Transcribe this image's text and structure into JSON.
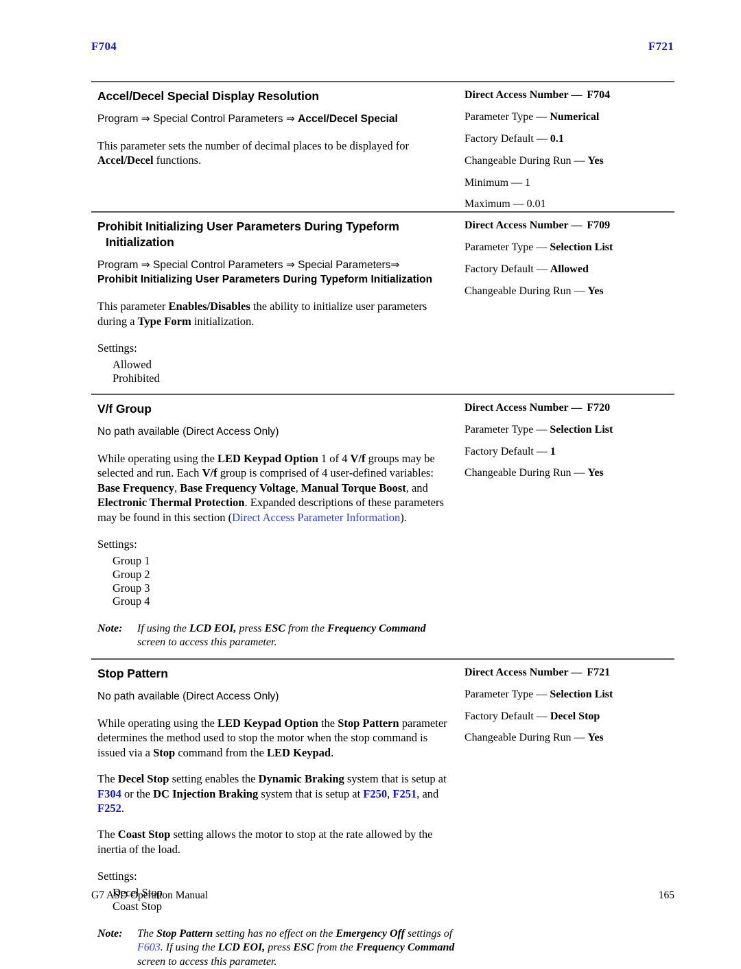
{
  "running_head": {
    "left": "F704",
    "right": "F721",
    "color": "#1515cc"
  },
  "footer": {
    "manual_title": "G7 ASD Operation Manual",
    "page_number": "165"
  },
  "meta_labels": {
    "direct_access_number": "Direct Access Number —",
    "parameter_type": "Parameter Type —",
    "factory_default": "Factory Default —",
    "changeable_during_run": "Changeable During Run —",
    "minimum": "Minimum —",
    "maximum": "Maximum —"
  },
  "common": {
    "settings_label": "Settings:",
    "note_label": "Note:",
    "no_path": "No path available (Direct Access Only)"
  },
  "sections": [
    {
      "id": "accel-decel-special-display-resolution",
      "title": "Accel/Decel Special Display Resolution",
      "title_line2": "",
      "path_prefix": "Program ⇒ Special Control Parameters ⇒ ",
      "path_bold": "Accel/Decel Special",
      "description_pre": "This parameter sets the number of decimal places to be displayed for ",
      "description_bold": "Accel/Decel",
      "description_post": " functions.",
      "meta": {
        "direct_access_number": "F704",
        "parameter_type": "Numerical",
        "factory_default": "0.1",
        "changeable_during_run": "Yes",
        "minimum": "1",
        "maximum": "0.01"
      }
    },
    {
      "id": "prohibit-initializing-user-parameters",
      "title": "Prohibit Initializing User Parameters During Typeform",
      "title_line2": "Initialization",
      "path_prefix": "Program ⇒ Special Control Parameters ⇒ Special Parameters⇒",
      "path_bold": "Prohibit Initializing User Parameters During Typeform Initialization",
      "description_pre": "This parameter ",
      "description_bold": "Enables/Disables",
      "description_mid": " the ability to initialize user parameters during a ",
      "description_bold2": "Type Form",
      "description_post": " initialization.",
      "settings": [
        "Allowed",
        "Prohibited"
      ],
      "meta": {
        "direct_access_number": "F709",
        "parameter_type": "Selection List",
        "factory_default": "Allowed",
        "changeable_during_run": "Yes"
      }
    },
    {
      "id": "vf-group",
      "title": "V/f Group",
      "path": "No path available (Direct Access Only)",
      "body_parts": [
        {
          "t": "While operating using the ",
          "b": false
        },
        {
          "t": "LED Keypad Option",
          "b": true
        },
        {
          "t": " 1 of 4 ",
          "b": false
        },
        {
          "t": "V/f",
          "b": true
        },
        {
          "t": " groups may be selected and run. Each ",
          "b": false
        },
        {
          "t": "V/f",
          "b": true
        },
        {
          "t": " group is comprised of 4 user-defined variables: ",
          "b": false
        },
        {
          "t": "Base Frequency",
          "b": true
        },
        {
          "t": ", ",
          "b": false
        },
        {
          "t": "Base Frequency Voltage",
          "b": true
        },
        {
          "t": ", ",
          "b": false
        },
        {
          "t": "Manual Torque Boost",
          "b": true
        },
        {
          "t": ", and ",
          "b": false
        },
        {
          "t": "Electronic Thermal Protection",
          "b": true
        },
        {
          "t": ". Expanded descriptions of these parameters may be found in this section (",
          "b": false
        },
        {
          "t": "Direct Access Parameter Information",
          "b": false,
          "link": true
        },
        {
          "t": ").",
          "b": false
        }
      ],
      "settings": [
        "Group 1",
        "Group 2",
        "Group 3",
        "Group 4"
      ],
      "note_parts": [
        {
          "t": "If using the ",
          "b": false
        },
        {
          "t": "LCD EOI,",
          "b": true
        },
        {
          "t": " press ",
          "b": false
        },
        {
          "t": "ESC",
          "b": true
        },
        {
          "t": " from the ",
          "b": false
        },
        {
          "t": "Frequency Command",
          "b": true
        },
        {
          "t": " screen to access this parameter.",
          "b": false
        }
      ],
      "meta": {
        "direct_access_number": "F720",
        "parameter_type": "Selection List",
        "factory_default": "1",
        "changeable_during_run": "Yes"
      }
    },
    {
      "id": "stop-pattern",
      "title": "Stop Pattern",
      "path": "No path available (Direct Access Only)",
      "body_parts": [
        {
          "t": "While operating using the ",
          "b": false
        },
        {
          "t": "LED Keypad Option",
          "b": true
        },
        {
          "t": " the ",
          "b": false
        },
        {
          "t": "Stop Pattern",
          "b": true
        },
        {
          "t": " parameter determines the method used to stop the motor when the stop command is issued via a ",
          "b": false
        },
        {
          "t": "Stop",
          "b": true
        },
        {
          "t": " command from the ",
          "b": false
        },
        {
          "t": "LED Keypad",
          "b": true
        },
        {
          "t": ".",
          "b": false
        }
      ],
      "body2_parts": [
        {
          "t": "The ",
          "b": false
        },
        {
          "t": "Decel Stop",
          "b": true
        },
        {
          "t": " setting enables the ",
          "b": false
        },
        {
          "t": "Dynamic Braking",
          "b": true
        },
        {
          "t": " system that is setup at ",
          "b": false
        },
        {
          "t": "F304",
          "b": true,
          "link": true
        },
        {
          "t": " or the ",
          "b": false
        },
        {
          "t": "DC Injection Braking",
          "b": true
        },
        {
          "t": " system that is setup at ",
          "b": false
        },
        {
          "t": "F250",
          "b": true,
          "link": true
        },
        {
          "t": ", ",
          "b": false
        },
        {
          "t": "F251",
          "b": true,
          "link": true
        },
        {
          "t": ", and ",
          "b": false
        },
        {
          "t": "F252",
          "b": true,
          "link": true
        },
        {
          "t": ".",
          "b": false
        }
      ],
      "body3_parts": [
        {
          "t": "The ",
          "b": false
        },
        {
          "t": "Coast Stop",
          "b": true
        },
        {
          "t": " setting allows the motor to stop at the rate allowed by the inertia of the load.",
          "b": false
        }
      ],
      "settings": [
        "Decel Stop",
        "Coast Stop"
      ],
      "note_parts": [
        {
          "t": "The ",
          "b": false
        },
        {
          "t": "Stop Pattern",
          "b": true
        },
        {
          "t": " setting has no effect on the ",
          "b": false
        },
        {
          "t": "Emergency Off",
          "b": true
        },
        {
          "t": " settings of ",
          "b": false
        },
        {
          "t": "F603",
          "b": false,
          "link": true
        },
        {
          "t": ". If using the ",
          "b": false
        },
        {
          "t": "LCD EOI,",
          "b": true
        },
        {
          "t": " press ",
          "b": false
        },
        {
          "t": "ESC",
          "b": true
        },
        {
          "t": " from the ",
          "b": false
        },
        {
          "t": "Frequency Command",
          "b": true
        },
        {
          "t": " screen to access this parameter.",
          "b": false
        }
      ],
      "meta": {
        "direct_access_number": "F721",
        "parameter_type": "Selection List",
        "factory_default": "Decel Stop",
        "changeable_during_run": "Yes"
      }
    }
  ]
}
